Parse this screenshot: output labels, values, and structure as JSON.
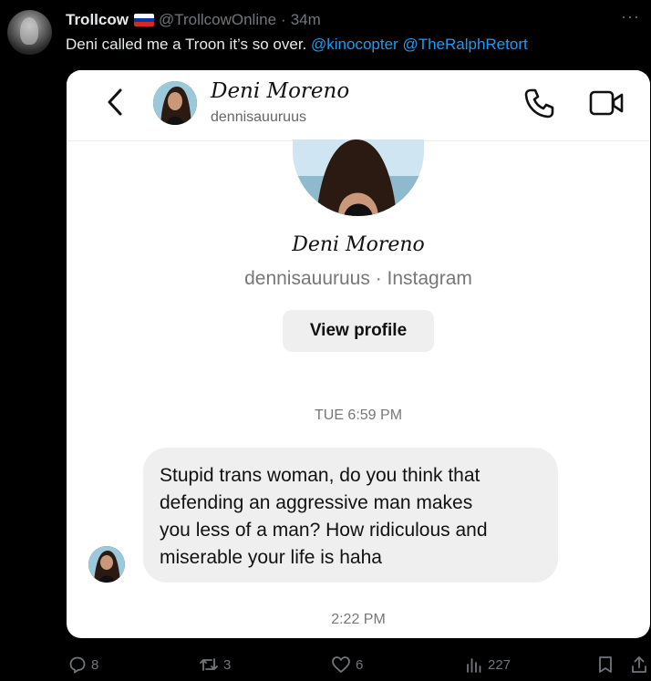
{
  "tweet": {
    "display_name": "Trollcow",
    "handle": "@TrollcowOnline",
    "separator": "·",
    "time": "34m",
    "more": "···",
    "text": "Deni called me a Troon it’s so over.",
    "mentions": [
      "@kinocopter",
      "@TheRalphRetort"
    ],
    "flag_colors": [
      "#ffffff",
      "#0039a6",
      "#d52b1e"
    ]
  },
  "dm": {
    "header_name": "Deni Moreno",
    "header_username": "dennisauuruus",
    "profile_name": "Deni Moreno",
    "profile_subtitle": "dennisauuruus · Instagram",
    "view_profile_label": "View profile",
    "timestamp_1": "TUE 6:59 PM",
    "message_lines": [
      "Stupid trans woman, do you think that",
      "defending an aggressive man makes",
      "you less of a man? How ridiculous and",
      "miserable your life is haha"
    ],
    "timestamp_2": "2:22 PM"
  },
  "actions": {
    "replies": "8",
    "retweets": "3",
    "likes": "6",
    "views": "227"
  },
  "colors": {
    "background": "#000000",
    "text": "#e7e9ea",
    "muted": "#71767b",
    "link": "#1d9bf0"
  }
}
